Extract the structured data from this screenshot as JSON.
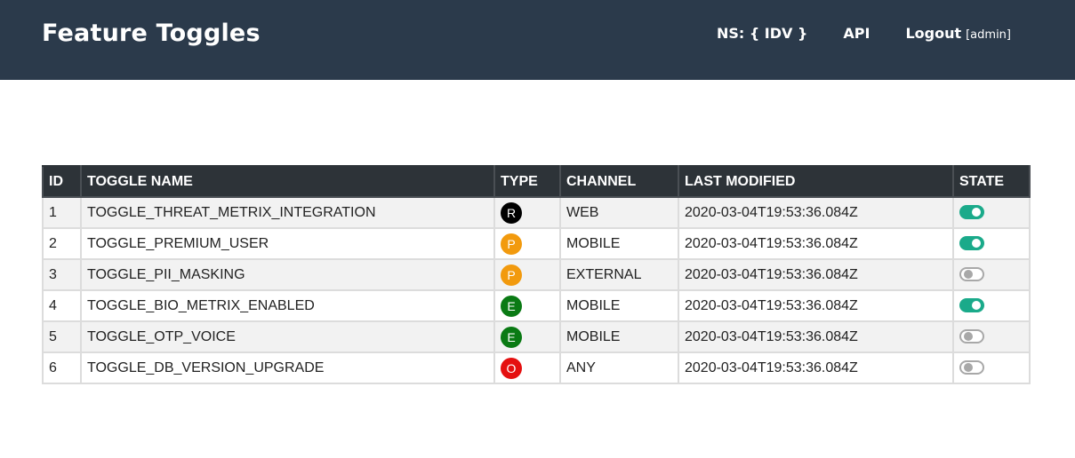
{
  "header": {
    "title": "Feature Toggles",
    "namespace": "NS: { IDV }",
    "api": "API",
    "logout": "Logout",
    "user": "[admin]"
  },
  "table": {
    "columns": [
      "ID",
      "TOGGLE NAME",
      "TYPE",
      "CHANNEL",
      "LAST MODIFIED",
      "STATE"
    ],
    "rows": [
      {
        "id": "1",
        "name": "TOGGLE_THREAT_METRIX_INTEGRATION",
        "type": "R",
        "type_color": "#000000",
        "channel": "WEB",
        "modified": "2020-03-04T19:53:36.084Z",
        "state": true
      },
      {
        "id": "2",
        "name": "TOGGLE_PREMIUM_USER",
        "type": "P",
        "type_color": "#f29a0e",
        "channel": "MOBILE",
        "modified": "2020-03-04T19:53:36.084Z",
        "state": true
      },
      {
        "id": "3",
        "name": "TOGGLE_PII_MASKING",
        "type": "P",
        "type_color": "#f29a0e",
        "channel": "EXTERNAL",
        "modified": "2020-03-04T19:53:36.084Z",
        "state": false
      },
      {
        "id": "4",
        "name": "TOGGLE_BIO_METRIX_ENABLED",
        "type": "E",
        "type_color": "#0a7a14",
        "channel": "MOBILE",
        "modified": "2020-03-04T19:53:36.084Z",
        "state": true
      },
      {
        "id": "5",
        "name": "TOGGLE_OTP_VOICE",
        "type": "E",
        "type_color": "#0a7a14",
        "channel": "MOBILE",
        "modified": "2020-03-04T19:53:36.084Z",
        "state": false
      },
      {
        "id": "6",
        "name": "TOGGLE_DB_VERSION_UPGRADE",
        "type": "O",
        "type_color": "#e51010",
        "channel": "ANY",
        "modified": "2020-03-04T19:53:36.084Z",
        "state": false
      }
    ]
  },
  "colors": {
    "header_bg": "#2b3a4b",
    "table_header_bg": "#2d3338",
    "toggle_on": "#1aaa8a",
    "toggle_off": "#a8a8a8"
  }
}
